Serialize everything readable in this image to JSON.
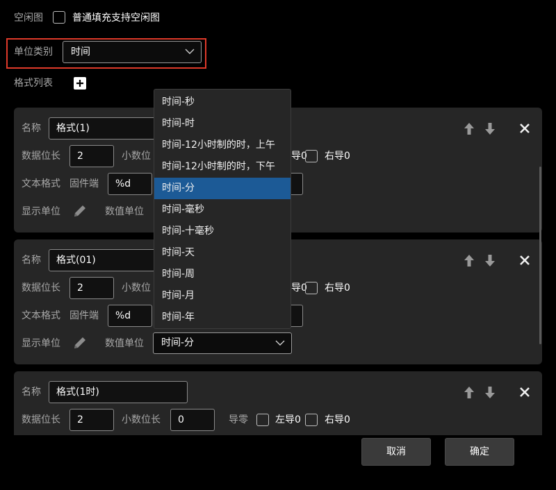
{
  "top": {
    "idle_label": "空闲图",
    "fill_checkbox_label": "普通填充支持空闲图"
  },
  "unit_type": {
    "label": "单位类别",
    "value": "时间"
  },
  "format_list": {
    "label": "格式列表"
  },
  "cards": [
    {
      "name_label": "名称",
      "name_value": "格式(1)",
      "data_len_label": "数据位长",
      "data_len_value": "2",
      "decimal_label": "小数位",
      "lead_left_tail": "导0",
      "lead_right_label": "右导0",
      "text_format_label": "文本格式",
      "firmware_label": "固件端",
      "format_value": "%d",
      "show_unit_label": "显示单位",
      "value_unit_label": "数值单位"
    },
    {
      "name_label": "名称",
      "name_value": "格式(01)",
      "data_len_label": "数据位长",
      "data_len_value": "2",
      "decimal_label": "小数位",
      "lead_left_tail": "导0",
      "lead_right_label": "右导0",
      "text_format_label": "文本格式",
      "firmware_label": "固件端",
      "format_value": "%d",
      "show_unit_label": "显示单位",
      "value_unit_label": "数值单位",
      "value_unit_value": "时间-分"
    },
    {
      "name_label": "名称",
      "name_value": "格式(1时)",
      "data_len_label": "数据位长",
      "data_len_value": "2",
      "decimal_label": "小数位长",
      "decimal_value": "0",
      "lead_zero_label": "导零",
      "lead_left_label": "左导0",
      "lead_right_label": "右导0"
    }
  ],
  "dropdown": {
    "options": [
      "时间-秒",
      "时间-时",
      "时间-12小时制的时，上午",
      "时间-12小时制的时，下午",
      "时间-分",
      "时间-毫秒",
      "时间-十毫秒",
      "时间-天",
      "时间-周",
      "时间-月",
      "时间-年"
    ],
    "selected": "时间-分"
  },
  "footer": {
    "cancel_label": "取消",
    "ok_label": "确定"
  },
  "colors": {
    "background": "#000000",
    "card": "#262626",
    "selected_option": "#1c5a96",
    "highlight_border": "#e03a2a"
  },
  "icons": [
    "checkbox",
    "chevron-down-icon",
    "plus-icon",
    "arrow-up-icon",
    "arrow-down-icon",
    "close-icon",
    "pencil-icon"
  ]
}
